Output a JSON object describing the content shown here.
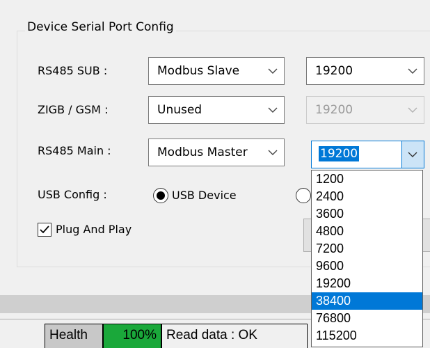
{
  "group": {
    "title": "Device Serial Port Config"
  },
  "rows": {
    "rs485_sub": {
      "label": "RS485 SUB :",
      "mode": "Modbus Slave",
      "baud": "19200"
    },
    "zigb_gsm": {
      "label": "ZIGB / GSM :",
      "mode": "Unused",
      "baud": "19200"
    },
    "rs485_main": {
      "label": "RS485 Main :",
      "mode": "Modbus Master",
      "baud": "19200"
    }
  },
  "usb": {
    "label": "USB Config :",
    "option_device": "USB Device",
    "selected": "USB Device"
  },
  "plug_and_play": {
    "label": "Plug And Play",
    "checked": true
  },
  "status_bar": {
    "health": "Health",
    "percent": "100%",
    "read": "Read data : OK"
  },
  "dropdown": {
    "options": [
      "1200",
      "2400",
      "3600",
      "4800",
      "7200",
      "9600",
      "19200",
      "38400",
      "76800",
      "115200"
    ],
    "highlighted": "38400"
  },
  "colors": {
    "accent": "#0078d7",
    "health_green": "#1aa83a",
    "hover_blue": "#cce4f7"
  },
  "icons": {
    "combo_arrow": "chevron-down-icon",
    "check": "checkmark-icon"
  }
}
